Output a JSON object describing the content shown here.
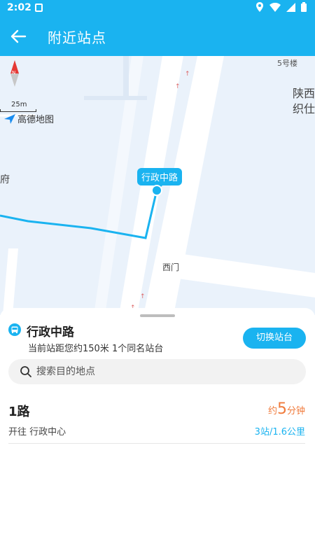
{
  "status": {
    "time": "2:02"
  },
  "header": {
    "title": "附近站点",
    "back_icon": "arrow-left-icon"
  },
  "map": {
    "scale_label": "25m",
    "provider": "高德地图",
    "labels": {
      "building": "5号楼",
      "area_a": "陕西",
      "area_b": "织仕",
      "left_fragment": "府",
      "gate": "西门"
    },
    "stop_marker": "行政中路",
    "colors": {
      "accent": "#1ab3f0",
      "route_line": "#1ab3f0",
      "road": "#ffffff",
      "background": "#eaf2fb"
    }
  },
  "panel": {
    "stop_name": "行政中路",
    "stop_info": "当前站距您约150米    1个同名站台",
    "switch_button": "切换站台",
    "search_placeholder": "搜索目的地点"
  },
  "routes": [
    {
      "name": "1路",
      "eta_prefix": "约",
      "eta_value": "5",
      "eta_unit": "分钟",
      "direction": "开往  行政中心",
      "distance": "3站/1.6公里"
    }
  ]
}
